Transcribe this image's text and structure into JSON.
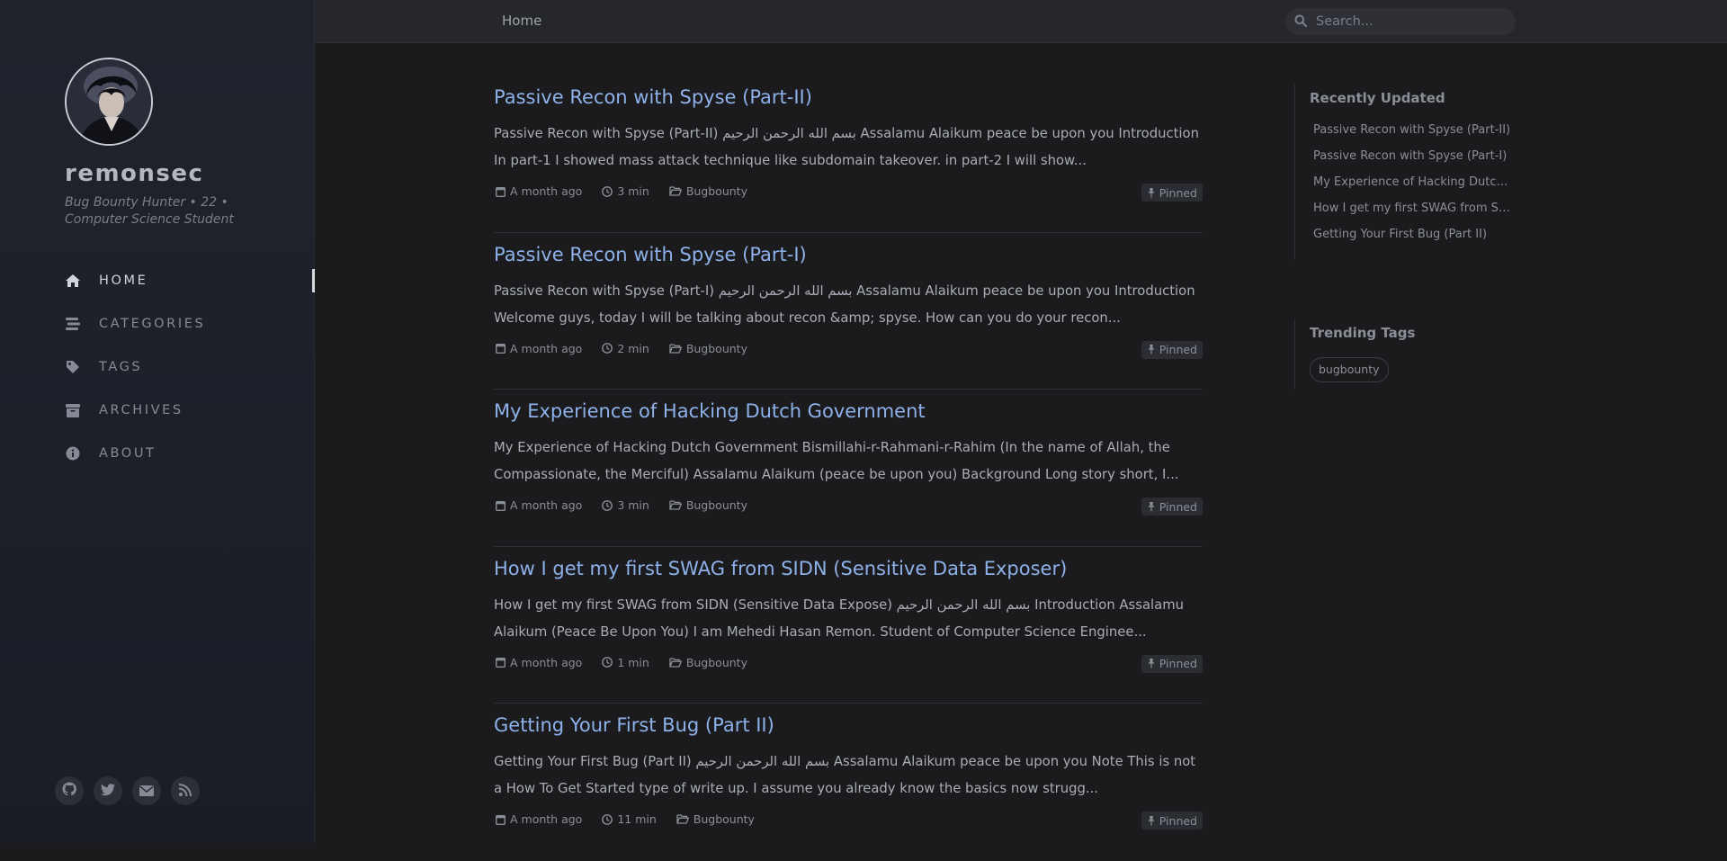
{
  "sidebar": {
    "avatar_alt": "remonsec avatar",
    "site_title": "remonsec",
    "site_subtitle": "Bug Bounty Hunter • 22 • Computer Science Student",
    "nav": [
      {
        "label": "HOME",
        "icon": "home-icon",
        "active": true
      },
      {
        "label": "CATEGORIES",
        "icon": "stream-icon",
        "active": false
      },
      {
        "label": "TAGS",
        "icon": "tag-icon",
        "active": false
      },
      {
        "label": "ARCHIVES",
        "icon": "archive-icon",
        "active": false
      },
      {
        "label": "ABOUT",
        "icon": "info-icon",
        "active": false
      }
    ],
    "social": [
      "github-icon",
      "twitter-icon",
      "email-icon",
      "rss-icon"
    ]
  },
  "topbar": {
    "breadcrumb": "Home",
    "search_placeholder": "Search..."
  },
  "posts": [
    {
      "title": "Passive Recon with Spyse (Part-II)",
      "excerpt": "Passive Recon with Spyse (Part-II) بسم الله الرحمن الرحيم Assalamu Alaikum peace be upon you Introduction In part-1 I showed mass attack technique like subdomain takeover. in part-2 I will show...",
      "date": "A month ago",
      "read_time": "3 min",
      "category": "Bugbounty",
      "badge": "Pinned"
    },
    {
      "title": "Passive Recon with Spyse (Part-I)",
      "excerpt": "Passive Recon with Spyse (Part-I) بسم الله الرحمن الرحيم Assalamu Alaikum peace be upon you Introduction Welcome guys, today I will be talking about recon &amp; spyse. How can you do your recon...",
      "date": "A month ago",
      "read_time": "2 min",
      "category": "Bugbounty",
      "badge": "Pinned"
    },
    {
      "title": "My Experience of Hacking Dutch Government",
      "excerpt": "My Experience of Hacking Dutch Government Bismillahi-r-Rahmani-r-Rahim (In the name of Allah, the Compassionate, the Merciful) Assalamu Alaikum (peace be upon you) Background Long story short, I...",
      "date": "A month ago",
      "read_time": "3 min",
      "category": "Bugbounty",
      "badge": "Pinned"
    },
    {
      "title": "How I get my first SWAG from SIDN (Sensitive Data Exposer)",
      "excerpt": "How I get my first SWAG from SIDN (Sensitive Data Expose) بسم الله الرحمن الرحيم Introduction Assalamu Alaikum (Peace Be Upon You) I am Mehedi Hasan Remon. Student of Computer Science Enginee...",
      "date": "A month ago",
      "read_time": "1 min",
      "category": "Bugbounty",
      "badge": "Pinned"
    },
    {
      "title": "Getting Your First Bug (Part II)",
      "excerpt": "Getting Your First Bug (Part II) بسم الله الرحمن الرحيم Assalamu Alaikum peace be upon you Note This is not a How To Get Started type of write up. I assume you already know the basics now strugg...",
      "date": "A month ago",
      "read_time": "11 min",
      "category": "Bugbounty",
      "badge": "Pinned"
    }
  ],
  "panel": {
    "recent_heading": "Recently Updated",
    "recent": [
      "Passive Recon with Spyse (Part-II)",
      "Passive Recon with Spyse (Part-I)",
      "My Experience of Hacking Dutch Government",
      "How I get my first SWAG from SIDN (Sensitive Data Exposer)",
      "Getting Your First Bug (Part II)"
    ],
    "trending_heading": "Trending Tags",
    "tags": [
      "bugbounty"
    ]
  }
}
